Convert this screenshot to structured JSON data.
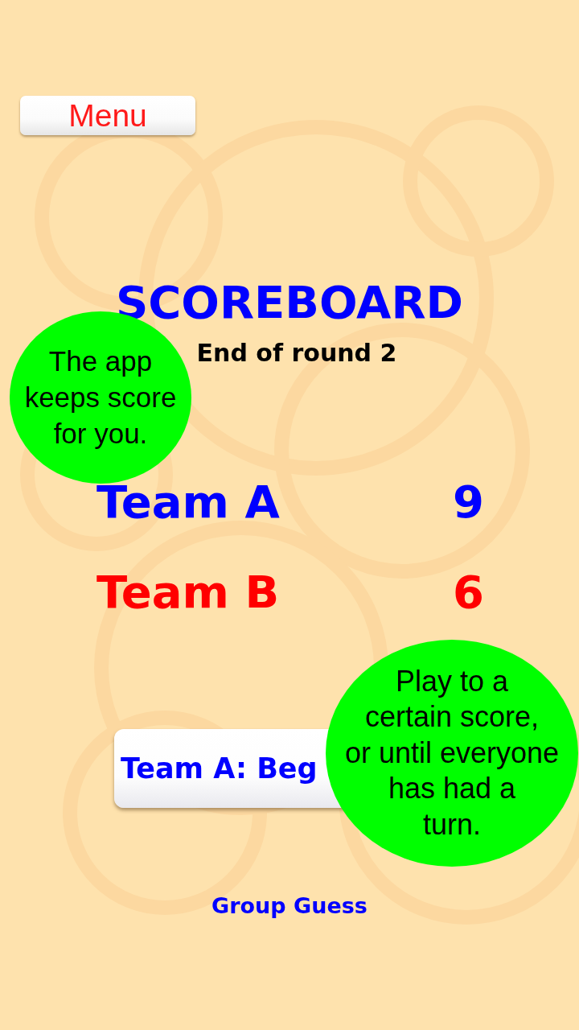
{
  "menu_button": {
    "label": "Menu"
  },
  "title": "SCOREBOARD",
  "subtitle": "End of round 2",
  "teams": [
    {
      "name": "Team A",
      "score": "9",
      "color": "#0000ff"
    },
    {
      "name": "Team B",
      "score": "6",
      "color": "#ff0000"
    }
  ],
  "start_button": {
    "label": "Team A: Beg"
  },
  "footer": "Group Guess",
  "callouts": [
    {
      "text": "The app\nkeeps score\nfor you."
    },
    {
      "text": "Play to a\ncertain score,\nor until everyone\nhas had a\nturn."
    }
  ]
}
